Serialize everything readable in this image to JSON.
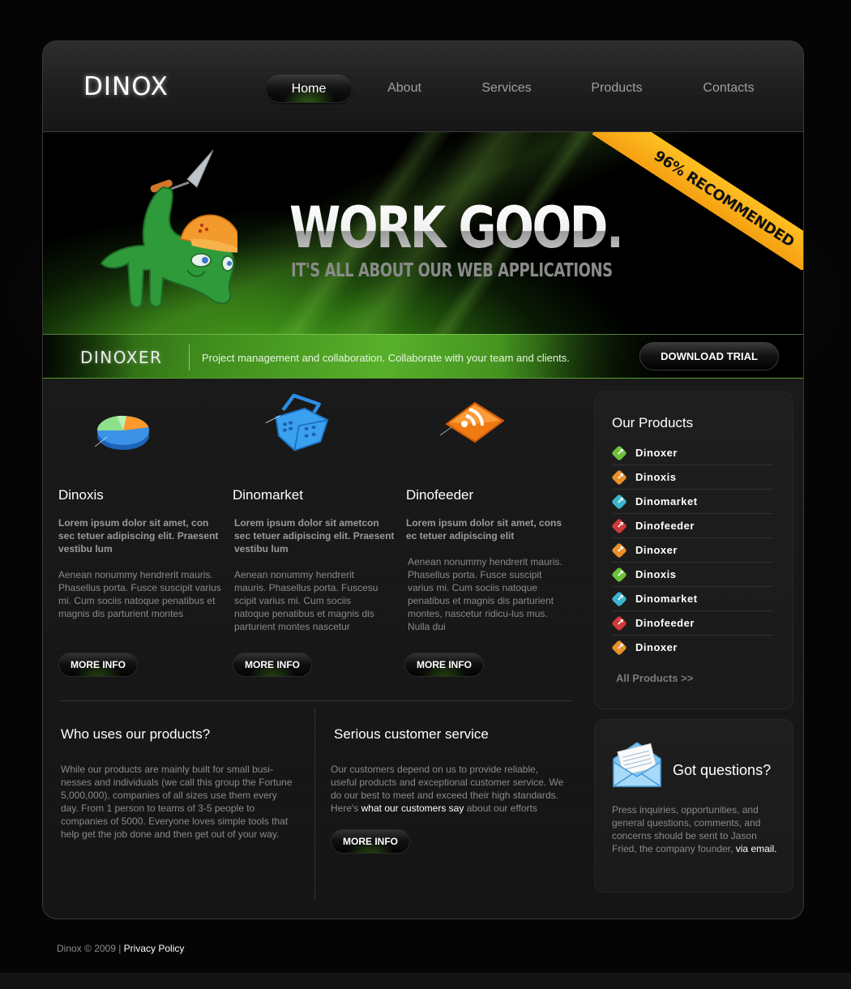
{
  "header": {
    "logo": "DINOX",
    "nav": [
      {
        "label": "Home",
        "active": true
      },
      {
        "label": "About",
        "active": false
      },
      {
        "label": "Services",
        "active": false
      },
      {
        "label": "Products",
        "active": false
      },
      {
        "label": "Contacts",
        "active": false
      }
    ]
  },
  "banner": {
    "headline": "WORK GOOD.",
    "subheadline": "IT'S ALL ABOUT OUR WEB APPLICATIONS",
    "ribbon": "96% RECOMMENDED",
    "ribbon_color": "#f9ab16",
    "mascot_icon": "dinosaur-mascot-icon"
  },
  "subbanner": {
    "product_name": "DINOXER",
    "description": "Project management and collaboration.  Collaborate with your team and clients.",
    "download_label": "DOWNLOAD TRIAL"
  },
  "features": [
    {
      "icon": "pie-chart-icon",
      "title": "Dinoxis",
      "lead": "Lorem ipsum dolor sit amet, con sec tetuer adipiscing elit. Praesent vestibu lum",
      "body": "Aenean nonummy hendrerit mauris. Phasellus porta. Fusce suscipit varius mi. Cum sociis natoque penatibus et magnis dis parturient montes",
      "button": "MORE INFO"
    },
    {
      "icon": "shopping-basket-icon",
      "title": "Dinomarket",
      "lead": "Lorem ipsum dolor sit ametcon sec tetuer adipiscing elit. Praesent vestibu lum",
      "body": "Aenean nonummy hendrerit mauris. Phasellus porta. Fuscesu scipit varius mi. Cum sociis natoque penatibus et magnis dis parturient montes nascetur",
      "button": "MORE INFO"
    },
    {
      "icon": "rss-feed-icon",
      "title": "Dinofeeder",
      "lead": "Lorem ipsum dolor sit amet, cons ec tetuer adipiscing elit",
      "body": "Aenean nonummy hendrerit mauris. Phasellus porta. Fusce suscipit varius mi. Cum sociis natoque penatibus et magnis dis parturient montes, nascetur ridicu-lus mus. Nulla dui",
      "button": "MORE INFO"
    }
  ],
  "who": {
    "title": "Who uses our products?",
    "body": "While our products are mainly built for small busi-nesses and individuals (we call this group the Fortune 5,000,000), companies of all sizes use them every day. From 1 person to teams of 3-5 people to companies of 5000. Everyone loves simple tools that help get the job done and then get out of your way."
  },
  "service": {
    "title": "Serious customer service",
    "body_before": "Our customers depend on us to provide reliable, useful products and exceptional customer service. We do our best to meet and exceed their high standards. Here's ",
    "link": "what our customers say",
    "body_after": " about our efforts",
    "button": "MORE INFO"
  },
  "sidebar": {
    "products_title": "Our Products",
    "products": [
      {
        "label": "Dinoxer",
        "color": "#6cc23a"
      },
      {
        "label": "Dinoxis",
        "color": "#e8902a"
      },
      {
        "label": "Dinomarket",
        "color": "#3cb6d0"
      },
      {
        "label": "Dinofeeder",
        "color": "#d03a3a"
      },
      {
        "label": "Dinoxer",
        "color": "#e8902a"
      },
      {
        "label": "Dinoxis",
        "color": "#6cc23a"
      },
      {
        "label": "Dinomarket",
        "color": "#3cb6d0"
      },
      {
        "label": "Dinofeeder",
        "color": "#d03a3a"
      },
      {
        "label": "Dinoxer",
        "color": "#e8902a"
      }
    ],
    "all_products": "All Products >>",
    "questions_title": "Got questions?",
    "questions_icon": "envelope-letter-icon",
    "questions_body": "Press inquiries, opportunities, and general questions, comments, and concerns should be sent to Jason Fried, the company founder, ",
    "questions_link": "via email."
  },
  "footer": {
    "copyright": "Dinox © 2009 | ",
    "privacy": "Privacy Policy"
  }
}
